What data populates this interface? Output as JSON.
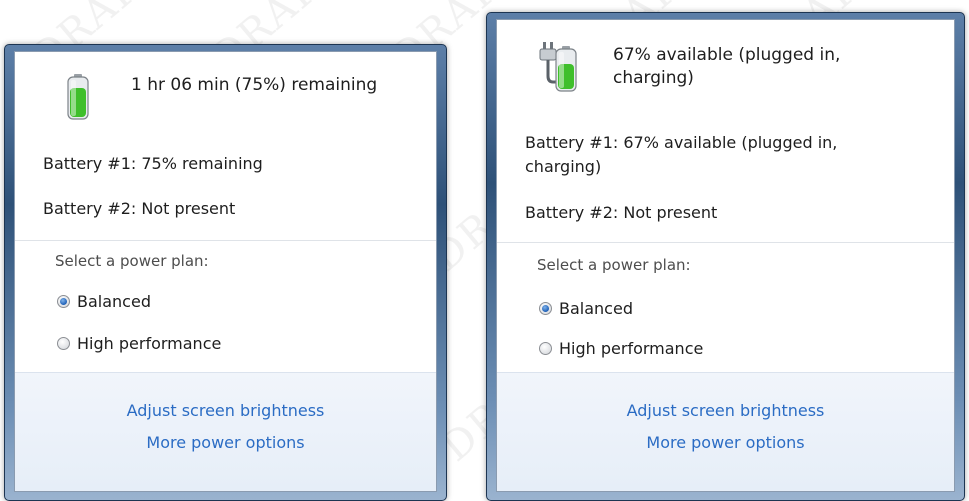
{
  "left_flyout": {
    "status": "1 hr 06 min (75%) remaining",
    "battery1": "Battery #1: 75% remaining",
    "battery2": "Battery #2: Not present",
    "plan_label": "Select a power plan:",
    "plans": [
      "Balanced",
      "High performance"
    ],
    "selected_plan": "Balanced",
    "links": [
      "Adjust screen brightness",
      "More power options"
    ],
    "charge_fraction": 0.75,
    "plugged_in": false
  },
  "right_flyout": {
    "status_line1": "67% available (plugged in,",
    "status_line2": "charging)",
    "battery1_line1": "Battery #1: 67% available (plugged in,",
    "battery1_line2": "charging)",
    "battery2": "Battery #2: Not present",
    "plan_label": "Select a power plan:",
    "plans": [
      "Balanced",
      "High performance"
    ],
    "selected_plan": "Balanced",
    "links": [
      "Adjust screen brightness",
      "More power options"
    ],
    "charge_fraction": 0.67,
    "plugged_in": true
  },
  "colors": {
    "link": "#2b6cc4",
    "battery_green": "#3fbf2b",
    "frame": "#2e5178"
  },
  "icons": {
    "battery": "battery-icon",
    "plug": "power-plug-icon"
  }
}
